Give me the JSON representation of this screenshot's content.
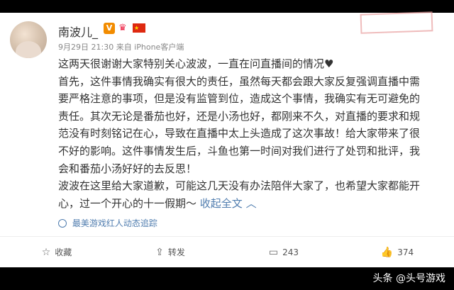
{
  "post": {
    "username": "南波儿_",
    "meta": "9月29日 21:30 来自 iPhone客户端",
    "paragraphs": [
      "这两天很谢谢大家特别关心波波，一直在问直播间的情况♥",
      "首先，这件事情我确实有很大的责任，虽然每天都会跟大家反复强调直播中需要严格注意的事项，但是没有监管到位，造成这个事情，我确实有无可避免的责任。其次无论是番茄也好，还是小汤也好，都刚来不久，对直播的要求和规范没有时刻铭记在心，导致在直播中太上头造成了这次事故！给大家带来了很不好的影响。这件事情发生后，斗鱼也第一时间对我们进行了处罚和批评，我会和番茄小汤好好的去反思！",
      "波波在这里给大家道歉，可能这几天没有办法陪伴大家了，也希望大家都能开心，过一个开心的十一假期～"
    ],
    "collapse_text": "收起全文",
    "source": "最美游戏红人动态追踪"
  },
  "actions": {
    "favorite": "收藏",
    "repost": "转发",
    "comment": "243",
    "like": "374"
  },
  "watermark": {
    "text": "头条 @头号游戏"
  },
  "icons": [
    "v-badge-icon",
    "crown-icon",
    "flag-icon",
    "source-icon",
    "star-icon",
    "repost-icon",
    "comment-icon",
    "like-icon"
  ]
}
